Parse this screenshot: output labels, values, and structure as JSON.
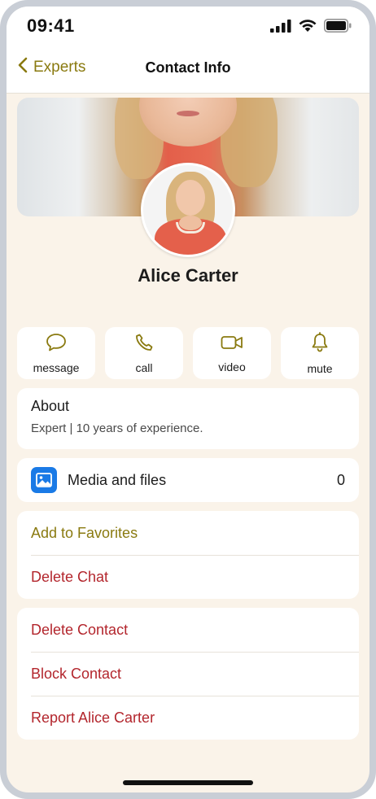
{
  "status_bar": {
    "time": "09:41"
  },
  "nav": {
    "back_label": "Experts",
    "title": "Contact Info"
  },
  "profile": {
    "name": "Alice Carter"
  },
  "actions": [
    {
      "label": "message",
      "icon": "chat-bubble-icon"
    },
    {
      "label": "call",
      "icon": "phone-icon"
    },
    {
      "label": "video",
      "icon": "video-camera-icon"
    },
    {
      "label": "mute",
      "icon": "bell-icon"
    }
  ],
  "about": {
    "title": "About",
    "text": "Expert | 10 years of experience."
  },
  "media": {
    "label": "Media and files",
    "count": "0",
    "icon": "image-icon"
  },
  "group1": {
    "add_favorites": "Add to Favorites",
    "delete_chat": "Delete Chat"
  },
  "group2": {
    "delete_contact": "Delete Contact",
    "block_contact": "Block Contact",
    "report": "Report Alice Carter"
  },
  "colors": {
    "accent": "#8a7a10",
    "destructive": "#b3262d",
    "background": "#faf3e9",
    "media_icon": "#1a7ae6"
  }
}
